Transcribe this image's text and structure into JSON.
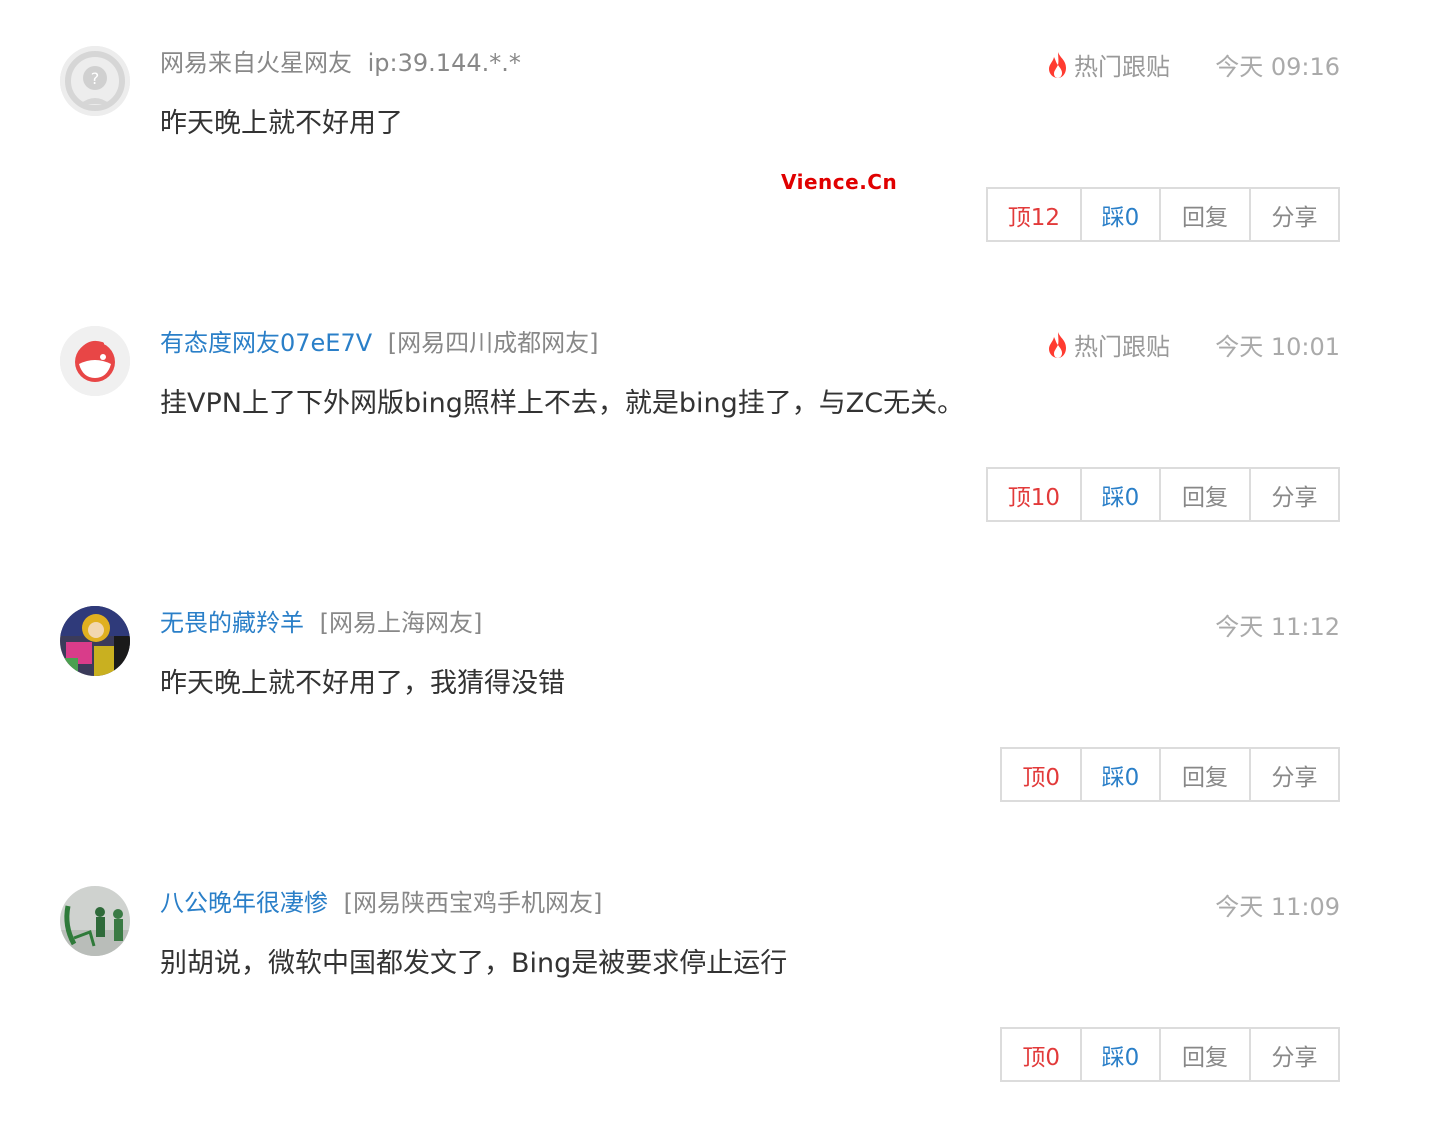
{
  "watermark": "Vience.Cn",
  "comments": [
    {
      "user": "网易来自火星网友",
      "location": "ip:39.144.*.*",
      "hot_label": "热门跟贴",
      "time": "今天 09:16",
      "content": "昨天晚上就不好用了",
      "up": "顶12",
      "down": "踩0",
      "reply": "回复",
      "share": "分享"
    },
    {
      "user": "有态度网友07eE7V",
      "location": "[网易四川成都网友]",
      "hot_label": "热门跟贴",
      "time": "今天 10:01",
      "content": "挂VPN上了下外网版bing照样上不去，就是bing挂了，与ZC无关。",
      "up": "顶10",
      "down": "踩0",
      "reply": "回复",
      "share": "分享"
    },
    {
      "user": "无畏的藏羚羊",
      "location": "[网易上海网友]",
      "time": "今天 11:12",
      "content": "昨天晚上就不好用了，我猜得没错",
      "up": "顶0",
      "down": "踩0",
      "reply": "回复",
      "share": "分享"
    },
    {
      "user": "八公晚年很凄惨",
      "location": "[网易陕西宝鸡手机网友]",
      "time": "今天 11:09",
      "content": "别胡说，微软中国都发文了，Bing是被要求停止运行",
      "up": "顶0",
      "down": "踩0",
      "reply": "回复",
      "share": "分享"
    }
  ],
  "colors": {
    "up": "#e23a3a",
    "down": "#2a7fc8",
    "user_link": "#2a7fc8",
    "muted": "#888888",
    "hot_icon": "#ff3b30",
    "watermark": "#e00000"
  },
  "icons": {
    "hot": "flame-icon",
    "avatars": [
      "default-avatar-icon",
      "mascot-avatar",
      "photo-avatar",
      "photo-avatar"
    ]
  }
}
